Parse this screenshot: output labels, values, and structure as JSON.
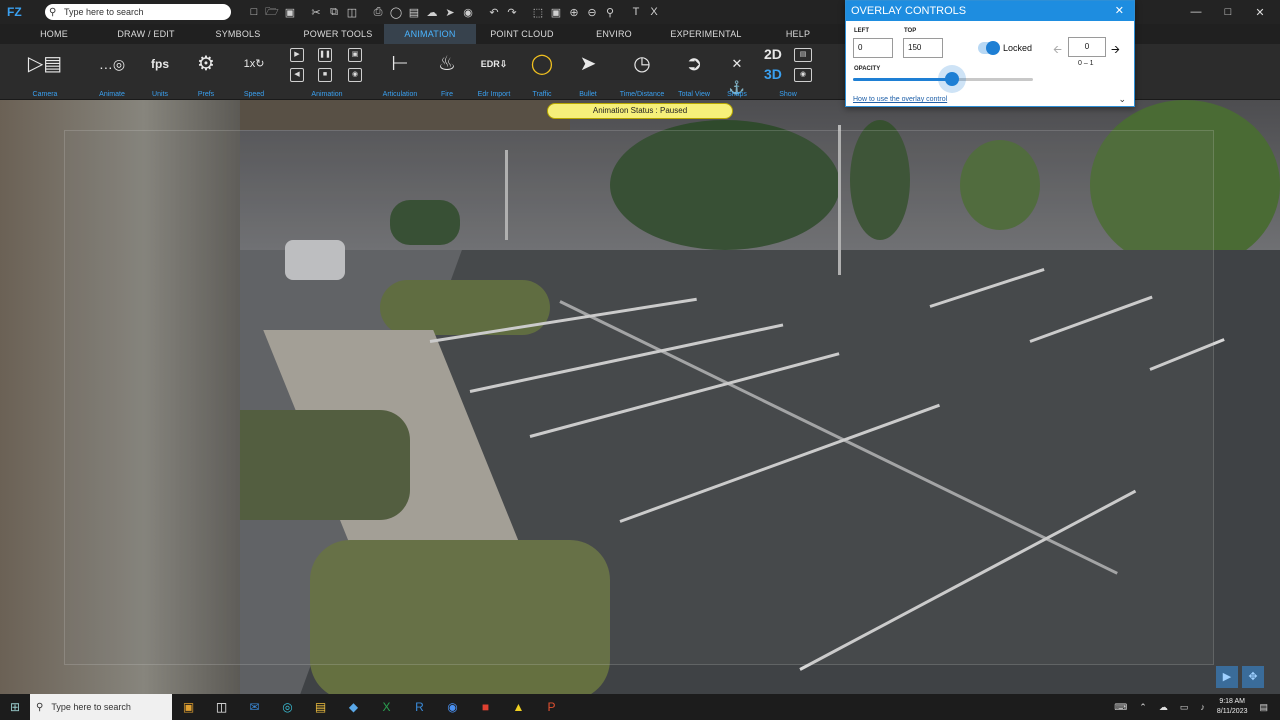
{
  "titlebar": {
    "logo": "FZ",
    "search_placeholder": "Type here to search",
    "app_title_fragment": "F",
    "quick_access_icons": [
      "new-file-icon",
      "open-folder-icon",
      "save-icon",
      "settings-icon",
      "cut-icon",
      "copy-icon",
      "paste-icon",
      "print-icon",
      "camera-icon",
      "print-preview-icon",
      "cloud-icon",
      "send-icon",
      "capture-icon",
      "undo-icon",
      "redo-icon",
      "select-region-icon",
      "zoom-extents-icon",
      "zoom-in-icon",
      "zoom-out-icon",
      "zoom-window-icon",
      "text-icon",
      "text-clear-icon"
    ]
  },
  "tabs": [
    "HOME",
    "DRAW / EDIT",
    "SYMBOLS",
    "POWER TOOLS",
    "ANIMATION",
    "POINT CLOUD",
    "ENVIRO",
    "EXPERIMENTAL",
    "HELP"
  ],
  "active_tab": "ANIMATION",
  "ribbon": {
    "groups": [
      {
        "label": "Camera",
        "icon": "camera-frame-icon"
      },
      {
        "label": "Animate",
        "icon": "animate-icon"
      },
      {
        "label": "Units",
        "icon": "fps-icon",
        "text": "fps"
      },
      {
        "label": "Prefs",
        "icon": "gear-icon"
      },
      {
        "label": "Speed",
        "icon": "speed-icon",
        "text": "1x"
      },
      {
        "label": "Animation",
        "icon": "animation-controls-icon"
      },
      {
        "label": "Articulation",
        "icon": "articulation-icon"
      },
      {
        "label": "Fire",
        "icon": "fire-icon"
      },
      {
        "label": "Edr Import",
        "icon": "edr-import-icon",
        "text": "EDR"
      },
      {
        "label": "Traffic",
        "icon": "traffic-light-icon"
      },
      {
        "label": "Bullet",
        "icon": "bullet-icon"
      },
      {
        "label": "Time/Distance",
        "icon": "clock-icon"
      },
      {
        "label": "Total View",
        "icon": "paper-plane-icon"
      },
      {
        "label": "Snaps",
        "icon": "snaps-icon"
      },
      {
        "label": "Show",
        "icon": "eye-icon"
      }
    ],
    "view_2d": "2D",
    "view_3d": "3D"
  },
  "status": "Animation Status : Paused",
  "overlay": {
    "title": "OVERLAY CONTROLS",
    "left_label": "LEFT",
    "left_value": "0",
    "top_label": "TOP",
    "top_value": "150",
    "locked_label": "Locked",
    "locked": true,
    "step_value": "0",
    "range_label": "0 – 1",
    "opacity_label": "OPACITY",
    "opacity": 0.55,
    "help_link": "How to use the overlay control"
  },
  "taskbar": {
    "search_placeholder": "Type here to search",
    "apps": [
      "briefcase-icon",
      "task-view-icon",
      "outlook-icon",
      "edge-icon",
      "file-explorer-icon",
      "app-store-icon",
      "excel-icon",
      "rhino-icon",
      "zoom-icon",
      "recorder-icon",
      "fz-app-icon",
      "powerpoint-icon"
    ],
    "time": "9:18 AM",
    "date": "8/11/2023"
  },
  "colors": {
    "accent": "#1e8de0",
    "active_tab_text": "#4ab4ff",
    "status_bg": "#f6f07a"
  }
}
